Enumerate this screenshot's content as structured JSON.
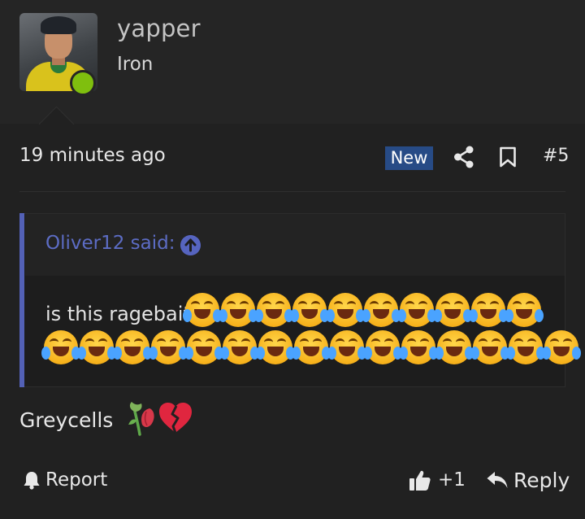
{
  "author": {
    "username": "yapper",
    "rank": "Iron",
    "status_color": "#7fbf0e"
  },
  "post": {
    "timestamp": "19 minutes ago",
    "badge": "New",
    "number": "#5"
  },
  "quote": {
    "author_label": "Oliver12 said:",
    "text": "is this ragebait",
    "emoji": "face-with-tears-of-joy",
    "emoji_count": 25,
    "accent_color": "#5361b6"
  },
  "reply": {
    "text": "Greycells",
    "emojis": [
      "wilted-rose",
      "broken-heart"
    ]
  },
  "actions": {
    "report": "Report",
    "like_count": "+1",
    "reply": "Reply"
  },
  "colors": {
    "background": "#212121",
    "badge": "#274b86",
    "link": "#5c6cc4"
  }
}
